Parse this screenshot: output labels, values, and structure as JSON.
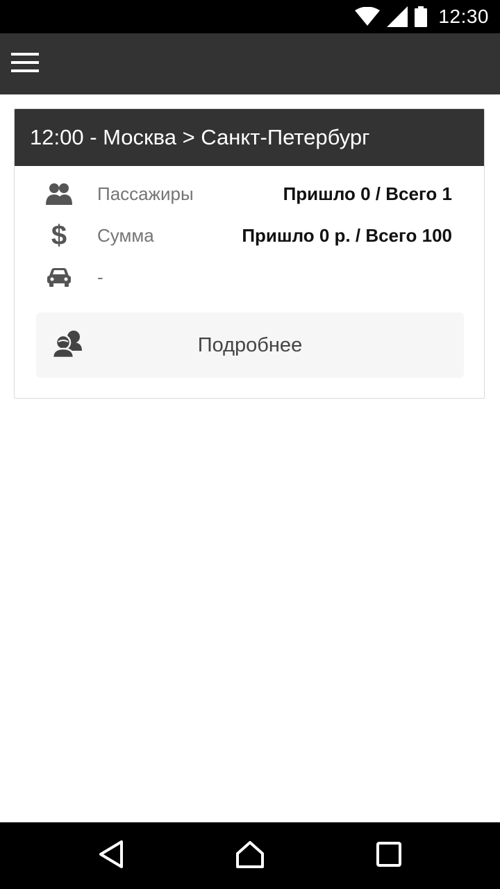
{
  "status_bar": {
    "time": "12:30",
    "icons": [
      "wifi-icon",
      "cell-signal-icon",
      "battery-icon"
    ]
  },
  "app_bar": {
    "menu_icon": "hamburger-menu-icon"
  },
  "trip_card": {
    "title": "12:00 - Москва > Санкт-Петербург",
    "rows": [
      {
        "icon": "passengers-icon",
        "label": "Пассажиры",
        "value": "Пришло 0 / Всего 1"
      },
      {
        "icon": "dollar-icon",
        "label": "Сумма",
        "value": "Пришло 0 р. / Всего 100"
      },
      {
        "icon": "car-icon",
        "label": "-",
        "value": ""
      }
    ],
    "details_button": {
      "icon": "users-icon",
      "label": "Подробнее"
    }
  },
  "nav_bar": {
    "icons": [
      "back-icon",
      "home-icon",
      "recents-icon"
    ]
  },
  "colors": {
    "app_bar": "#333333",
    "status_bar": "#000000",
    "button_bg": "#f6f6f6",
    "label_gray": "#757575"
  }
}
